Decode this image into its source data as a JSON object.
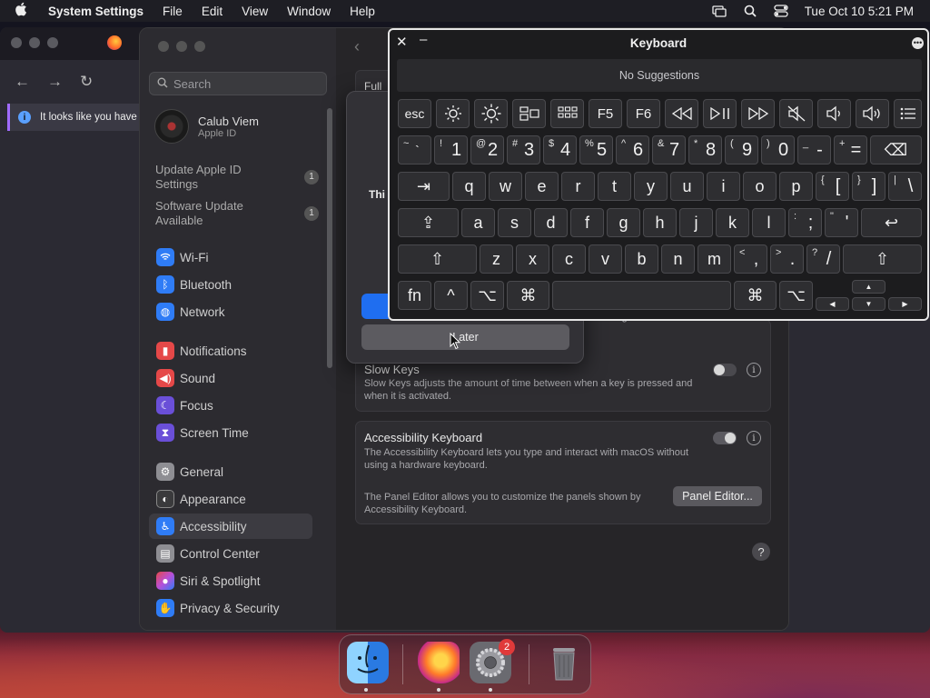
{
  "menubar": {
    "apple": "",
    "app_name": "System Settings",
    "menus": [
      "File",
      "Edit",
      "View",
      "Window",
      "Help"
    ],
    "clock": "Tue Oct 10  5:21 PM",
    "icons": [
      "screen-mirroring-icon",
      "search-icon",
      "control-center-icon"
    ]
  },
  "firefox": {
    "notice": "It looks like you have"
  },
  "settings": {
    "search_placeholder": "Search",
    "user": {
      "name": "Calub Viem",
      "subtitle": "Apple ID"
    },
    "updates": [
      {
        "label": "Update Apple ID Settings",
        "count": "1"
      },
      {
        "label": "Software Update Available",
        "count": "1"
      }
    ],
    "sidebar": [
      {
        "label": "Wi-Fi",
        "icon": "wifi-icon",
        "color": "#2f7cf6"
      },
      {
        "label": "Bluetooth",
        "icon": "bluetooth-icon",
        "color": "#2f7cf6"
      },
      {
        "label": "Network",
        "icon": "network-icon",
        "color": "#2f7cf6"
      },
      {
        "label": "Notifications",
        "icon": "bell-icon",
        "color": "#e54848"
      },
      {
        "label": "Sound",
        "icon": "speaker-icon",
        "color": "#e54848"
      },
      {
        "label": "Focus",
        "icon": "moon-icon",
        "color": "#6a4fd8"
      },
      {
        "label": "Screen Time",
        "icon": "hourglass-icon",
        "color": "#6a4fd8"
      },
      {
        "label": "General",
        "icon": "gear-icon",
        "color": "#8e8e93"
      },
      {
        "label": "Appearance",
        "icon": "appearance-icon",
        "color": "#3a3a3c"
      },
      {
        "label": "Accessibility",
        "icon": "accessibility-icon",
        "color": "#2f7cf6"
      },
      {
        "label": "Control Center",
        "icon": "control-center-icon",
        "color": "#8e8e93"
      },
      {
        "label": "Siri & Spotlight",
        "icon": "siri-icon",
        "color": "#b84fd8"
      },
      {
        "label": "Privacy & Security",
        "icon": "hand-icon",
        "color": "#2f7cf6"
      }
    ],
    "active_item": "Accessibility",
    "main": {
      "full_label": "Full",
      "hold_fragment": "out having to hold the",
      "slow_keys": {
        "title": "Slow Keys",
        "desc": "Slow Keys adjusts the amount of time between when a key is pressed and when it is activated.",
        "enabled": false
      },
      "acc_keyboard": {
        "title": "Accessibility Keyboard",
        "desc": "The Accessibility Keyboard lets you type and interact with macOS without using a hardware keyboard.",
        "enabled": true,
        "panel_desc": "The Panel Editor allows you to customize the panels shown by Accessibility Keyboard.",
        "panel_button": "Panel Editor..."
      },
      "help": "?"
    }
  },
  "sheet": {
    "text_fragment": "Thi",
    "later_button": "Later"
  },
  "keyboard": {
    "title": "Keyboard",
    "suggestions": "No Suggestions",
    "options_icon": "•••",
    "fn_row": [
      "esc",
      "☼",
      "☀",
      "▤",
      "▦",
      "F5",
      "F6",
      "⏪",
      "⏯",
      "⏩",
      "🔇",
      "🔈",
      "🔊",
      "☰"
    ],
    "num_row": [
      {
        "top": "~",
        "main": "`"
      },
      {
        "top": "!",
        "main": "1"
      },
      {
        "top": "@",
        "main": "2"
      },
      {
        "top": "#",
        "main": "3"
      },
      {
        "top": "$",
        "main": "4"
      },
      {
        "top": "%",
        "main": "5"
      },
      {
        "top": "^",
        "main": "6"
      },
      {
        "top": "&",
        "main": "7"
      },
      {
        "top": "*",
        "main": "8"
      },
      {
        "top": "(",
        "main": "9"
      },
      {
        "top": ")",
        "main": "0"
      },
      {
        "top": "_",
        "main": "-"
      },
      {
        "top": "+",
        "main": "="
      }
    ],
    "delete": "⌫",
    "tab": "⇥",
    "row_q": [
      "q",
      "w",
      "e",
      "r",
      "t",
      "y",
      "u",
      "i",
      "o",
      "p"
    ],
    "row_q_sym": [
      {
        "top": "{",
        "main": "["
      },
      {
        "top": "}",
        "main": "]"
      },
      {
        "top": "|",
        "main": "\\"
      }
    ],
    "caps": "⇪",
    "row_a": [
      "a",
      "s",
      "d",
      "f",
      "g",
      "h",
      "j",
      "k",
      "l"
    ],
    "row_a_sym": [
      {
        "top": ":",
        "main": ";"
      },
      {
        "top": "\"",
        "main": "'"
      }
    ],
    "return": "↩",
    "shift": "⇧",
    "row_z": [
      "z",
      "x",
      "c",
      "v",
      "b",
      "n",
      "m"
    ],
    "row_z_sym": [
      {
        "top": "<",
        "main": ","
      },
      {
        "top": ">",
        "main": "."
      },
      {
        "top": "?",
        "main": "/"
      }
    ],
    "bottom": {
      "fn": "fn",
      "ctrl": "^",
      "opt": "⌥",
      "cmd": "⌘",
      "cmd_r": "⌘",
      "opt_r": "⌥"
    },
    "arrows": {
      "up": "▲",
      "left": "◀",
      "down": "▼",
      "right": "▶"
    }
  },
  "dock": {
    "apps": [
      "Finder",
      "Firefox",
      "System Settings",
      "Trash"
    ],
    "settings_badge": "2"
  }
}
